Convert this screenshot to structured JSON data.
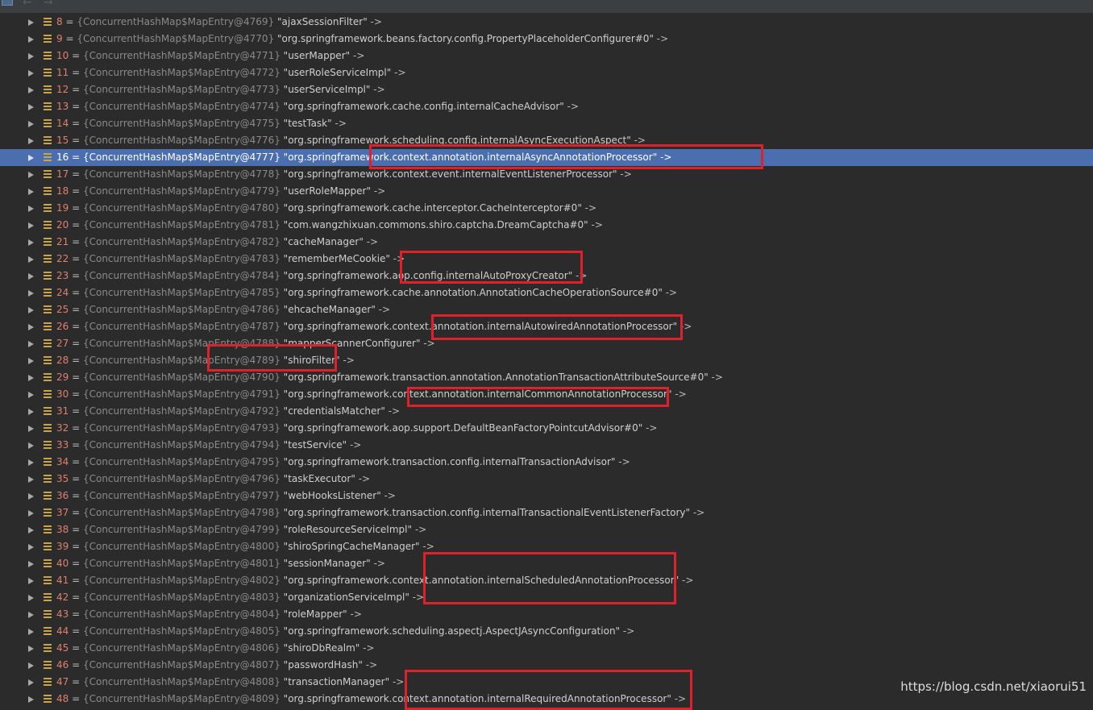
{
  "toolbar": {
    "back_glyph": "←",
    "forward_glyph": "→",
    "icons": [
      "watch-panel-icon",
      "back-arrow-icon",
      "forward-arrow-icon"
    ]
  },
  "colors": {
    "background": "#2b2b2b",
    "selection": "#4b6eaf",
    "index": "#e0806d",
    "highlight_box": "#e0202a"
  },
  "rows": [
    {
      "index": "8",
      "object": "{ConcurrentHashMap$MapEntry@4769}",
      "key": "\"ajaxSessionFilter\"",
      "arrow": "->"
    },
    {
      "index": "9",
      "object": "{ConcurrentHashMap$MapEntry@4770}",
      "key": "\"org.springframework.beans.factory.config.PropertyPlaceholderConfigurer#0\"",
      "arrow": "->"
    },
    {
      "index": "10",
      "object": "{ConcurrentHashMap$MapEntry@4771}",
      "key": "\"userMapper\"",
      "arrow": "->"
    },
    {
      "index": "11",
      "object": "{ConcurrentHashMap$MapEntry@4772}",
      "key": "\"userRoleServiceImpl\"",
      "arrow": "->"
    },
    {
      "index": "12",
      "object": "{ConcurrentHashMap$MapEntry@4773}",
      "key": "\"userServiceImpl\"",
      "arrow": "->"
    },
    {
      "index": "13",
      "object": "{ConcurrentHashMap$MapEntry@4774}",
      "key": "\"org.springframework.cache.config.internalCacheAdvisor\"",
      "arrow": "->"
    },
    {
      "index": "14",
      "object": "{ConcurrentHashMap$MapEntry@4775}",
      "key": "\"testTask\"",
      "arrow": "->"
    },
    {
      "index": "15",
      "object": "{ConcurrentHashMap$MapEntry@4776}",
      "key": "\"org.springframework.scheduling.config.internalAsyncExecutionAspect\"",
      "arrow": "->"
    },
    {
      "index": "16",
      "object": "{ConcurrentHashMap$MapEntry@4777}",
      "key": "\"org.springframework.context.annotation.internalAsyncAnnotationProcessor\"",
      "arrow": "->"
    },
    {
      "index": "17",
      "object": "{ConcurrentHashMap$MapEntry@4778}",
      "key": "\"org.springframework.context.event.internalEventListenerProcessor\"",
      "arrow": "->"
    },
    {
      "index": "18",
      "object": "{ConcurrentHashMap$MapEntry@4779}",
      "key": "\"userRoleMapper\"",
      "arrow": "->"
    },
    {
      "index": "19",
      "object": "{ConcurrentHashMap$MapEntry@4780}",
      "key": "\"org.springframework.cache.interceptor.CacheInterceptor#0\"",
      "arrow": "->"
    },
    {
      "index": "20",
      "object": "{ConcurrentHashMap$MapEntry@4781}",
      "key": "\"com.wangzhixuan.commons.shiro.captcha.DreamCaptcha#0\"",
      "arrow": "->"
    },
    {
      "index": "21",
      "object": "{ConcurrentHashMap$MapEntry@4782}",
      "key": "\"cacheManager\"",
      "arrow": "->"
    },
    {
      "index": "22",
      "object": "{ConcurrentHashMap$MapEntry@4783}",
      "key": "\"rememberMeCookie\"",
      "arrow": "->"
    },
    {
      "index": "23",
      "object": "{ConcurrentHashMap$MapEntry@4784}",
      "key": "\"org.springframework.aop.config.internalAutoProxyCreator\"",
      "arrow": "->"
    },
    {
      "index": "24",
      "object": "{ConcurrentHashMap$MapEntry@4785}",
      "key": "\"org.springframework.cache.annotation.AnnotationCacheOperationSource#0\"",
      "arrow": "->"
    },
    {
      "index": "25",
      "object": "{ConcurrentHashMap$MapEntry@4786}",
      "key": "\"ehcacheManager\"",
      "arrow": "->"
    },
    {
      "index": "26",
      "object": "{ConcurrentHashMap$MapEntry@4787}",
      "key": "\"org.springframework.context.annotation.internalAutowiredAnnotationProcessor\"",
      "arrow": "->"
    },
    {
      "index": "27",
      "object": "{ConcurrentHashMap$MapEntry@4788}",
      "key": "\"mapperScannerConfigurer\"",
      "arrow": "->"
    },
    {
      "index": "28",
      "object": "{ConcurrentHashMap$MapEntry@4789}",
      "key": "\"shiroFilter\"",
      "arrow": "->"
    },
    {
      "index": "29",
      "object": "{ConcurrentHashMap$MapEntry@4790}",
      "key": "\"org.springframework.transaction.annotation.AnnotationTransactionAttributeSource#0\"",
      "arrow": "->"
    },
    {
      "index": "30",
      "object": "{ConcurrentHashMap$MapEntry@4791}",
      "key": "\"org.springframework.context.annotation.internalCommonAnnotationProcessor\"",
      "arrow": "->"
    },
    {
      "index": "31",
      "object": "{ConcurrentHashMap$MapEntry@4792}",
      "key": "\"credentialsMatcher\"",
      "arrow": "->"
    },
    {
      "index": "32",
      "object": "{ConcurrentHashMap$MapEntry@4793}",
      "key": "\"org.springframework.aop.support.DefaultBeanFactoryPointcutAdvisor#0\"",
      "arrow": "->"
    },
    {
      "index": "33",
      "object": "{ConcurrentHashMap$MapEntry@4794}",
      "key": "\"testService\"",
      "arrow": "->"
    },
    {
      "index": "34",
      "object": "{ConcurrentHashMap$MapEntry@4795}",
      "key": "\"org.springframework.transaction.config.internalTransactionAdvisor\"",
      "arrow": "->"
    },
    {
      "index": "35",
      "object": "{ConcurrentHashMap$MapEntry@4796}",
      "key": "\"taskExecutor\"",
      "arrow": "->"
    },
    {
      "index": "36",
      "object": "{ConcurrentHashMap$MapEntry@4797}",
      "key": "\"webHooksListener\"",
      "arrow": "->"
    },
    {
      "index": "37",
      "object": "{ConcurrentHashMap$MapEntry@4798}",
      "key": "\"org.springframework.transaction.config.internalTransactionalEventListenerFactory\"",
      "arrow": "->"
    },
    {
      "index": "38",
      "object": "{ConcurrentHashMap$MapEntry@4799}",
      "key": "\"roleResourceServiceImpl\"",
      "arrow": "->"
    },
    {
      "index": "39",
      "object": "{ConcurrentHashMap$MapEntry@4800}",
      "key": "\"shiroSpringCacheManager\"",
      "arrow": "->"
    },
    {
      "index": "40",
      "object": "{ConcurrentHashMap$MapEntry@4801}",
      "key": "\"sessionManager\"",
      "arrow": "->"
    },
    {
      "index": "41",
      "object": "{ConcurrentHashMap$MapEntry@4802}",
      "key": "\"org.springframework.context.annotation.internalScheduledAnnotationProcessor\"",
      "arrow": "->"
    },
    {
      "index": "42",
      "object": "{ConcurrentHashMap$MapEntry@4803}",
      "key": "\"organizationServiceImpl\"",
      "arrow": "->"
    },
    {
      "index": "43",
      "object": "{ConcurrentHashMap$MapEntry@4804}",
      "key": "\"roleMapper\"",
      "arrow": "->"
    },
    {
      "index": "44",
      "object": "{ConcurrentHashMap$MapEntry@4805}",
      "key": "\"org.springframework.scheduling.aspectj.AspectJAsyncConfiguration\"",
      "arrow": "->"
    },
    {
      "index": "45",
      "object": "{ConcurrentHashMap$MapEntry@4806}",
      "key": "\"shiroDbRealm\"",
      "arrow": "->"
    },
    {
      "index": "46",
      "object": "{ConcurrentHashMap$MapEntry@4807}",
      "key": "\"passwordHash\"",
      "arrow": "->"
    },
    {
      "index": "47",
      "object": "{ConcurrentHashMap$MapEntry@4808}",
      "key": "\"transactionManager\"",
      "arrow": "->"
    },
    {
      "index": "48",
      "object": "{ConcurrentHashMap$MapEntry@4809}",
      "key": "\"org.springframework.context.annotation.internalRequiredAnnotationProcessor\"",
      "arrow": "->"
    }
  ],
  "selected_index": "16",
  "watermark": "https://blog.csdn.net/xiaorui51"
}
